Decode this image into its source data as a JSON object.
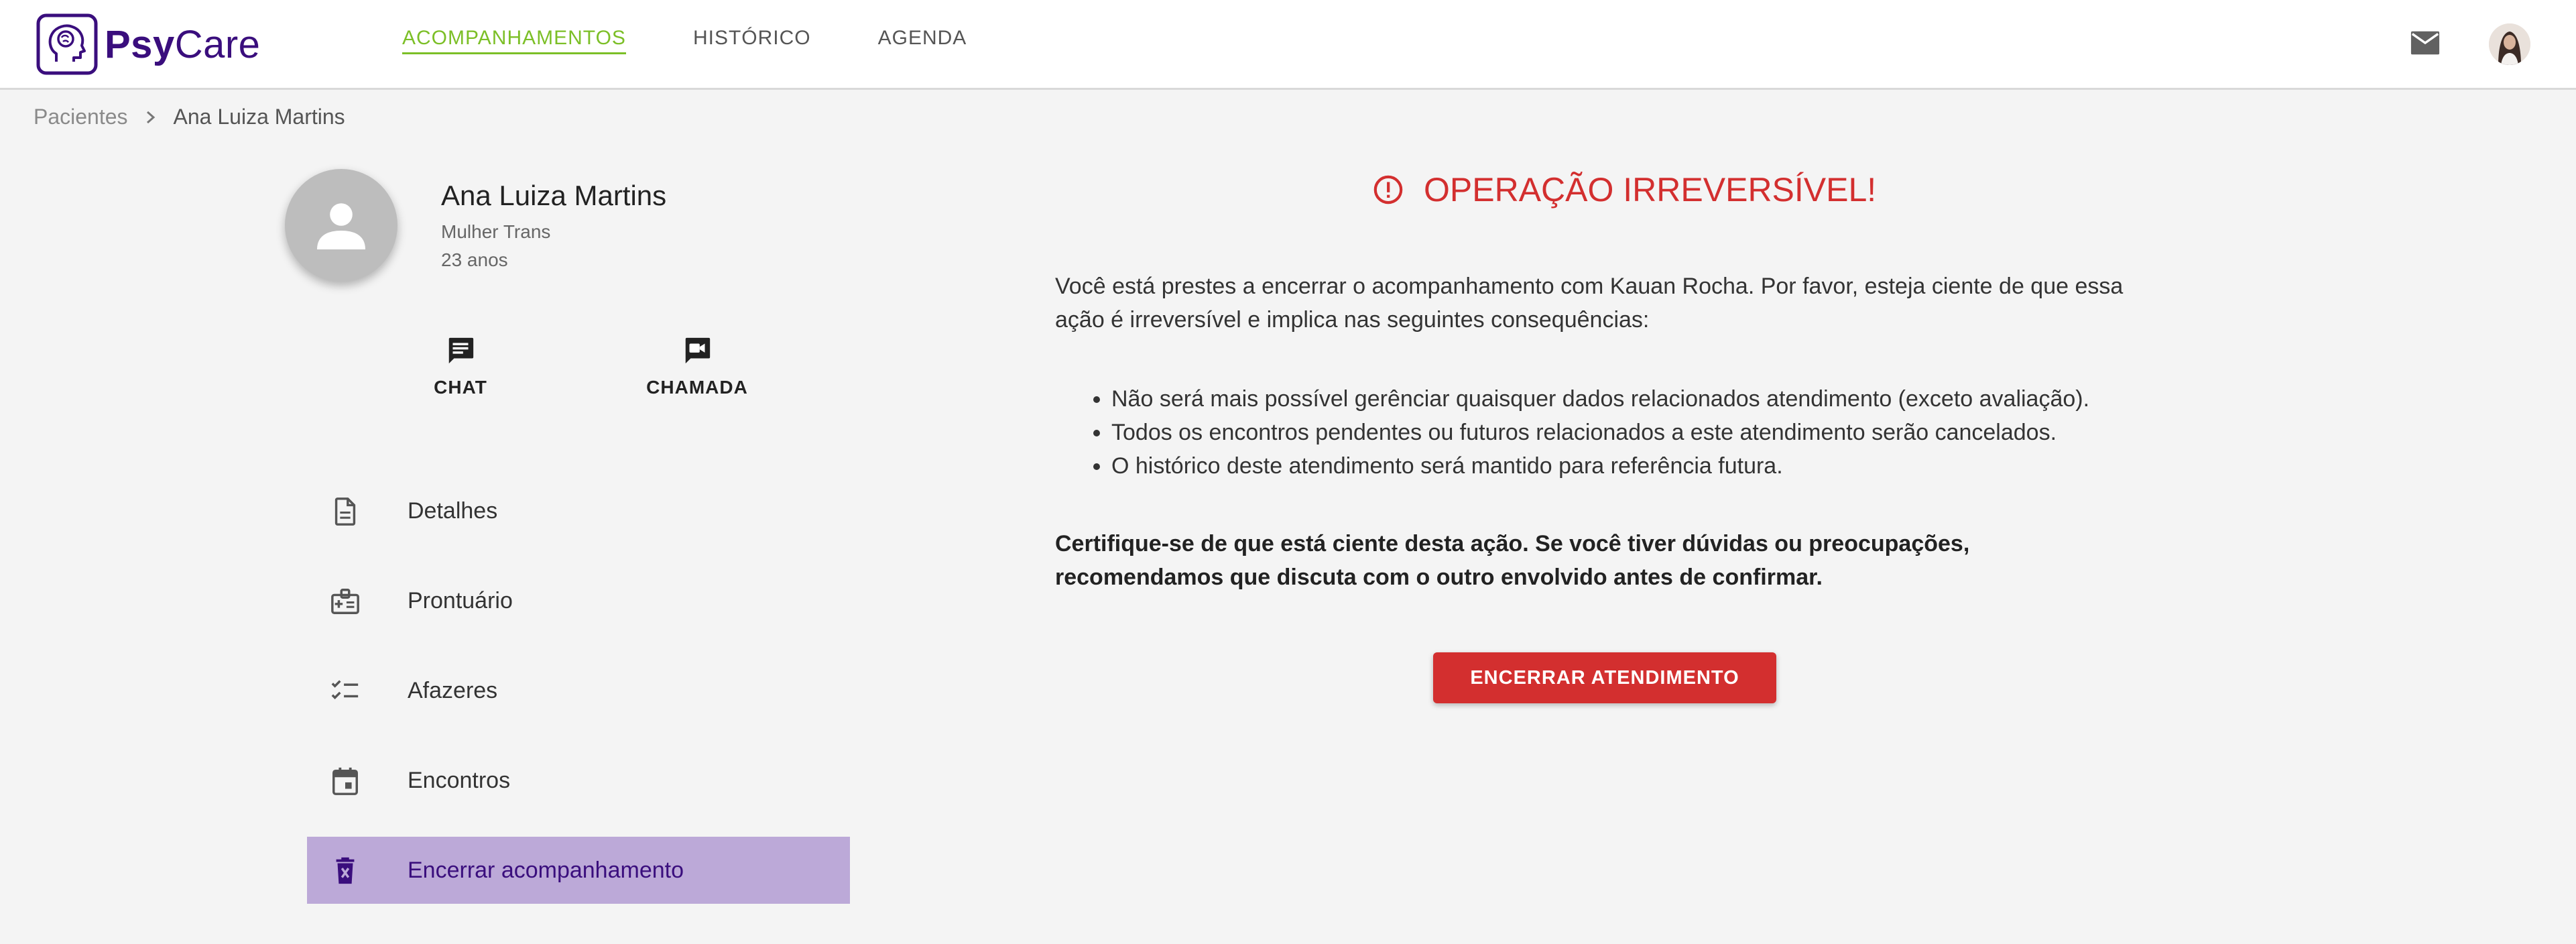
{
  "app": {
    "brand_left": "Psy",
    "brand_right": "Care"
  },
  "nav": {
    "items": [
      {
        "label": "ACOMPANHAMENTOS",
        "active": true
      },
      {
        "label": "HISTÓRICO",
        "active": false
      },
      {
        "label": "AGENDA",
        "active": false
      }
    ]
  },
  "header_icons": {
    "mail": "mail-icon",
    "avatar": "user-avatar"
  },
  "breadcrumb": {
    "parent": "Pacientes",
    "current": "Ana Luiza Martins"
  },
  "patient": {
    "name": "Ana Luiza Martins",
    "gender": "Mulher Trans",
    "age": "23 anos",
    "actions": {
      "chat": "CHAT",
      "call": "CHAMADA"
    }
  },
  "menu": {
    "items": [
      {
        "label": "Detalhes",
        "icon": "document-icon"
      },
      {
        "label": "Prontuário",
        "icon": "medical-record-icon"
      },
      {
        "label": "Afazeres",
        "icon": "checklist-icon"
      },
      {
        "label": "Encontros",
        "icon": "calendar-icon"
      },
      {
        "label": "Encerrar acompanhamento",
        "icon": "trash-icon",
        "active": true
      }
    ]
  },
  "warning": {
    "title": "OPERAÇÃO IRREVERSÍVEL!",
    "intro": "Você está prestes a encerrar o acompanhamento com Kauan Rocha. Por favor, esteja ciente de que essa ação é irreversível e implica nas seguintes consequências:",
    "bullets": [
      "Não será mais possível gerênciar quaisquer dados relacionados atendimento (exceto avaliação).",
      "Todos os encontros pendentes ou futuros relacionados a este atendimento serão cancelados.",
      "O histórico deste atendimento será mantido para referência futura."
    ],
    "note": "Certifique-se de que está ciente desta ação. Se você tiver dúvidas ou preocupações, recomendamos que discuta com o outro envolvido antes de confirmar.",
    "button": "ENCERRAR ATENDIMENTO"
  },
  "colors": {
    "brand": "#3a0e7d",
    "nav_active": "#7cbf27",
    "danger": "#d32f2f",
    "menu_active_bg": "#bca9d8"
  }
}
